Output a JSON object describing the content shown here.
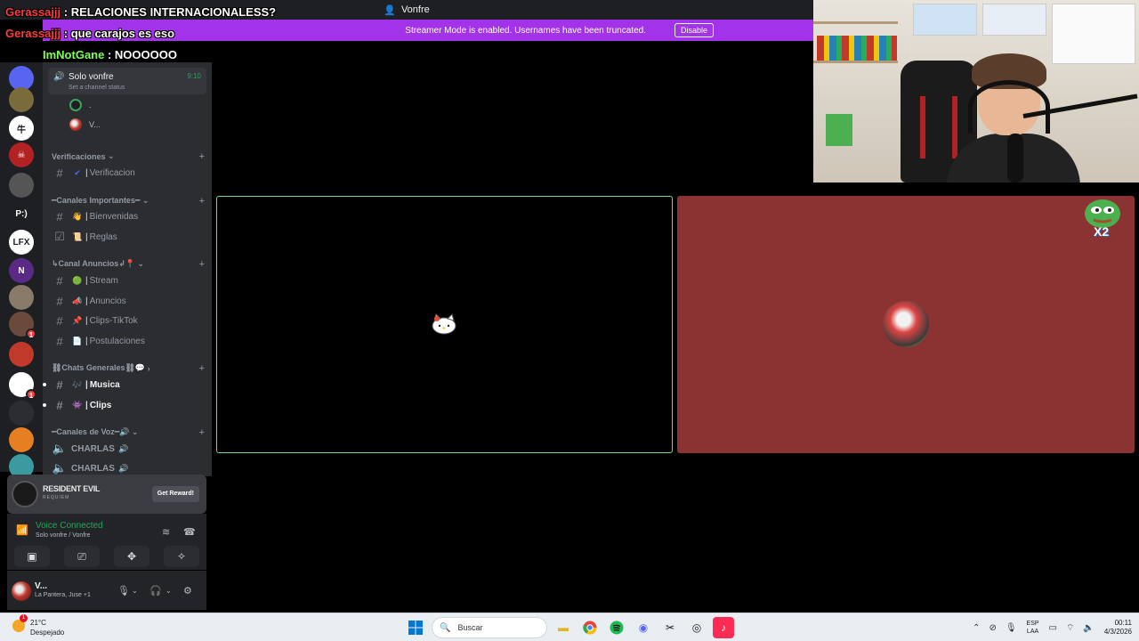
{
  "window": {
    "title": "Vonfre",
    "title_icon": "user-icon"
  },
  "banner": {
    "message": "Streamer Mode is enabled. Usernames have been truncated.",
    "disable_label": "Disable"
  },
  "chat_overlay": [
    {
      "user": "Gerassajjj",
      "message": ": RELACIONES INTERNACIONALESS?"
    },
    {
      "user": "Gerassajjj",
      "message": ": que carajos es eso"
    },
    {
      "user": "ImNotGane",
      "message": ": NOOOOOO"
    }
  ],
  "voice_channel_top": {
    "name": "Solo vonfre",
    "time": "9:10",
    "status": "Set a channel status"
  },
  "voice_members": [
    {
      "name": "."
    },
    {
      "name": "V..."
    }
  ],
  "categories": [
    {
      "name": "Verificaciones",
      "channels": [
        {
          "emoji": "✔",
          "name": "Verificacion"
        }
      ]
    },
    {
      "name": "━Canales Importantes━",
      "channels": [
        {
          "emoji": "👋",
          "name": "Bienvenidas"
        },
        {
          "emoji": "📜",
          "name": "Reglas"
        }
      ]
    },
    {
      "name": "↳Canal Anuncios↲📍",
      "channels": [
        {
          "emoji": "🟢",
          "name": "Stream"
        },
        {
          "emoji": "📣",
          "name": "Anuncios"
        },
        {
          "emoji": "📌",
          "name": "Clips-TikTok"
        },
        {
          "emoji": "📄",
          "name": "Postulaciones"
        }
      ]
    },
    {
      "name": "⛓Chats Generales⛓💬",
      "channels": [
        {
          "emoji": "🎶",
          "name": "Musica"
        },
        {
          "emoji": "👾",
          "name": "Clips"
        }
      ]
    },
    {
      "name": "━Canales de Voz━🔊",
      "channels": [
        {
          "emoji": "🔊",
          "name": "CHARLAS"
        },
        {
          "emoji": "🔊",
          "name": "CHARLAS"
        }
      ]
    }
  ],
  "reward": {
    "title": "RESIDENT EVIL",
    "subtitle": "REQUIEM",
    "button": "Get Reward!"
  },
  "voice_panel": {
    "status": "Voice Connected",
    "channel": "Solo vonfre / Vonfre"
  },
  "user": {
    "name": "V...",
    "activity": "La Pantera, Juse +1"
  },
  "servers": [
    {
      "label": "",
      "color": "#5865f2",
      "badge": ""
    },
    {
      "label": "",
      "color": "#7a6b3a",
      "badge": ""
    },
    {
      "label": "牛",
      "color": "#ffffff",
      "badge": ""
    },
    {
      "label": "☠",
      "color": "#b22222",
      "badge": ""
    },
    {
      "label": "",
      "color": "#555555",
      "badge": ""
    },
    {
      "label": "P:)",
      "color": "#1e1f22",
      "badge": ""
    },
    {
      "label": "LFX",
      "color": "#ffffff",
      "badge": ""
    },
    {
      "label": "N",
      "color": "#5b2a86",
      "badge": ""
    },
    {
      "label": "",
      "color": "#8a7a6a",
      "badge": ""
    },
    {
      "label": "",
      "color": "#6a4a3a",
      "badge": "1"
    },
    {
      "label": "",
      "color": "#c0392b",
      "badge": ""
    },
    {
      "label": "",
      "color": "#ffffff",
      "badge": "1"
    },
    {
      "label": "",
      "color": "#2b2d31",
      "badge": ""
    },
    {
      "label": "",
      "color": "#e67e22",
      "badge": ""
    },
    {
      "label": "",
      "color": "#3a9aa0",
      "badge": ""
    }
  ],
  "pepe_text": "X2",
  "taskbar": {
    "weather_temp": "21°C",
    "weather_desc": "Despejado",
    "weather_badge": "1",
    "search_placeholder": "Buscar",
    "lang_top": "ESP",
    "lang_bottom": "LAA",
    "time": "00:11",
    "date": "4/3/2026"
  },
  "colors": {
    "accent_purple": "#a333e8",
    "voice_green": "#23a55a",
    "tile_red": "#8b3232"
  }
}
